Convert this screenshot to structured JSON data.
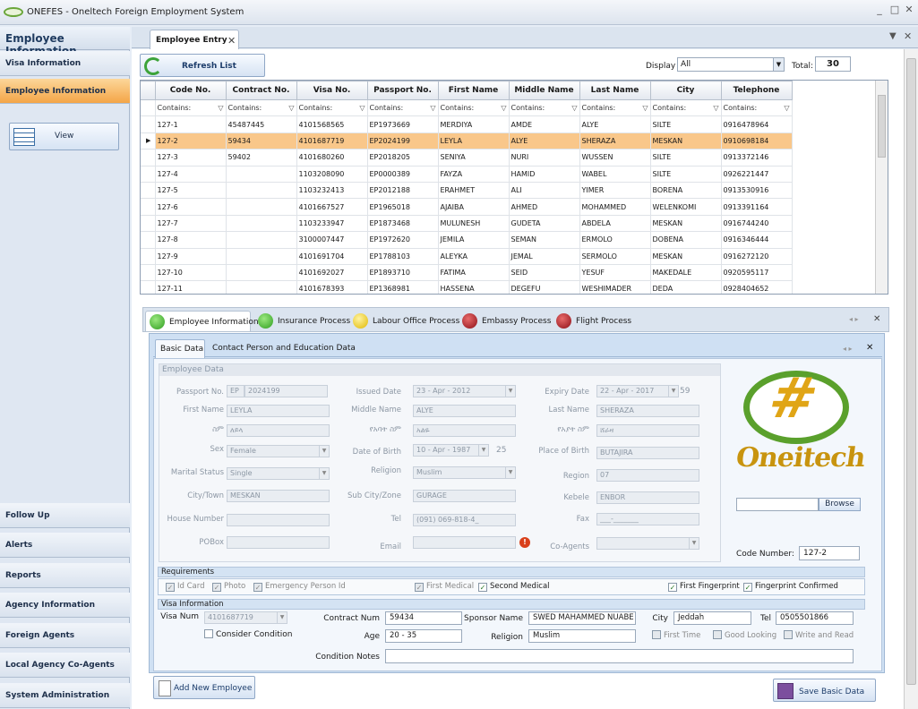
{
  "app": {
    "title": "ONEFES - Oneltech Foreign Employment System",
    "min": "_",
    "max": "□",
    "close": "✕"
  },
  "nav": {
    "header": "Employee Information",
    "view_label": "View",
    "items": [
      {
        "label": "Visa Information"
      },
      {
        "label": "Employee Information"
      },
      {
        "label": "Follow Up"
      },
      {
        "label": "Alerts"
      },
      {
        "label": "Reports"
      },
      {
        "label": "Agency Information"
      },
      {
        "label": "Foreign Agents"
      },
      {
        "label": "Local Agency Co-Agents"
      },
      {
        "label": "System Administration"
      }
    ]
  },
  "doc_tab": {
    "label": "Employee Entry",
    "close": "✕"
  },
  "toolbar": {
    "refresh_label": "Refresh List",
    "display_label": "Display",
    "display_value": "All",
    "total_label": "Total:",
    "total_value": "30"
  },
  "grid": {
    "columns": [
      "Code No.",
      "Contract No.",
      "Visa No.",
      "Passport No.",
      "First Name",
      "Middle Name",
      "Last Name",
      "City",
      "Telephone"
    ],
    "filter_text": "Contains:",
    "rows": [
      [
        "127-1",
        "45487445",
        "4101568565",
        "EP1973669",
        "MERDIYA",
        "AMDE",
        "ALYE",
        "SILTE",
        "0916478964"
      ],
      [
        "127-2",
        "59434",
        "4101687719",
        "EP2024199",
        "LEYLA",
        "ALYE",
        "SHERAZA",
        "MESKAN",
        "0910698184"
      ],
      [
        "127-3",
        "59402",
        "4101680260",
        "EP2018205",
        "SENIYA",
        "NURI",
        "WUSSEN",
        "SILTE",
        "0913372146"
      ],
      [
        "127-4",
        "",
        "1103208090",
        "EP0000389",
        "FAYZA",
        "HAMID",
        "WABEL",
        "SILTE",
        "0926221447"
      ],
      [
        "127-5",
        "",
        "1103232413",
        "EP2012188",
        "ERAHMET",
        "ALI",
        "YIMER",
        "BORENA",
        "0913530916"
      ],
      [
        "127-6",
        "",
        "4101667527",
        "EP1965018",
        "AJAIBA",
        "AHMED",
        "MOHAMMED",
        "WELENKOMI",
        "0913391164"
      ],
      [
        "127-7",
        "",
        "1103233947",
        "EP1873468",
        "MULUNESH",
        "GUDETA",
        "ABDELA",
        "MESKAN",
        "0916744240"
      ],
      [
        "127-8",
        "",
        "3100007447",
        "EP1972620",
        "JEMILA",
        "SEMAN",
        "ERMOLO",
        "DOBENA",
        "0916346444"
      ],
      [
        "127-9",
        "",
        "4101691704",
        "EP1788103",
        "ALEYKA",
        "JEMAL",
        "SERMOLO",
        "MESKAN",
        "0916272120"
      ],
      [
        "127-10",
        "",
        "4101692027",
        "EP1893710",
        "FATIMA",
        "SEID",
        "YESUF",
        "MAKEDALE",
        "0920595117"
      ],
      [
        "127-11",
        "",
        "4101678393",
        "EP1368981",
        "HASSENA",
        "DEGEFU",
        "WESHIMADER",
        "DEDA",
        "0928404652"
      ]
    ],
    "selected_row": 1
  },
  "process_tabs": [
    {
      "label": "Employee Information",
      "color": "#3fbf2e"
    },
    {
      "label": "Insurance Process",
      "color": "#3fbf2e"
    },
    {
      "label": "Labour Office Process",
      "color": "#f2d21c"
    },
    {
      "label": "Embassy Process",
      "color": "#b3141f"
    },
    {
      "label": "Flight Process",
      "color": "#b3141f"
    }
  ],
  "inner_tabs": {
    "basic": "Basic Data",
    "contact": "Contact Person and Education Data"
  },
  "employee": {
    "section": "Employee Data",
    "passport_label": "Passport No.",
    "passport_prefix": "EP",
    "passport_no": "2024199",
    "issued_label": "Issued Date",
    "issued": "23 - Apr - 2012",
    "expiry_label": "Expiry Date",
    "expiry": "22 - Apr - 2017",
    "expiry_years": "59",
    "first_name_label": "First Name",
    "first_name": "LEYLA",
    "middle_name_label": "Middle Name",
    "middle_name": "ALYE",
    "last_name_label": "Last Name",
    "last_name": "SHERAZA",
    "am_name_label": "ስም",
    "am_name": "ለይላ",
    "am_father_label": "የአባት ስም",
    "am_father": "አልዬ",
    "am_gfather_label": "የአያት ስም",
    "am_gfather": "ሸራዛ",
    "sex_label": "Sex",
    "sex": "Female",
    "dob_label": "Date of Birth",
    "dob": "10 - Apr - 1987",
    "age": "25",
    "pob_label": "Place of Birth",
    "pob": "BUTAJIRA",
    "marital_label": "Marital Status",
    "marital": "Single",
    "religion_label": "Religion",
    "religion": "Muslim",
    "region_label": "Region",
    "region": "07",
    "city_label": "City/Town",
    "city": "MESKAN",
    "subcity_label": "Sub City/Zone",
    "subcity": "GURAGE",
    "kebele_label": "Kebele",
    "kebele": "ENBOR",
    "house_label": "House Number",
    "house": "",
    "tel_label": "Tel",
    "tel": "(091) 069-818-4_",
    "fax_label": "Fax",
    "fax": "___-_______",
    "pobox_label": "POBox",
    "pobox": "",
    "email_label": "Email",
    "email": "",
    "coagents_label": "Co-Agents",
    "coagents": "",
    "browse_label": "Browse",
    "code_label": "Code Number:",
    "code": "127-2"
  },
  "logo": {
    "text": "Oneitech",
    "symbol": "#"
  },
  "requirements": {
    "header": "Requirements",
    "items": [
      {
        "label": "Id Card",
        "checked": true,
        "enabled": false
      },
      {
        "label": "Photo",
        "checked": true,
        "enabled": false
      },
      {
        "label": "Emergency Person Id",
        "checked": true,
        "enabled": false
      },
      {
        "label": "First Medical",
        "checked": true,
        "enabled": false
      },
      {
        "label": "Second Medical",
        "checked": true,
        "enabled": true
      },
      {
        "label": "First Fingerprint",
        "checked": true,
        "enabled": true
      },
      {
        "label": "Fingerprint Confirmed",
        "checked": true,
        "enabled": true
      }
    ]
  },
  "visa": {
    "header": "Visa Information",
    "visa_num_label": "Visa Num",
    "visa_num": "4101687719",
    "consider_label": "Consider Condition",
    "contract_label": "Contract Num",
    "contract": "59434",
    "sponsor_label": "Sponsor Name",
    "sponsor": "SWED MAHAMMED NUABE",
    "city_label": "City",
    "city": "Jeddah",
    "tel_label": "Tel",
    "tel": "0505501866",
    "age_label": "Age",
    "age": "20 - 35",
    "religion_label": "Religion",
    "religion": "Muslim",
    "first_time_label": "First Time",
    "good_looking_label": "Good Looking",
    "write_read_label": "Write and Read",
    "notes_label": "Condition Notes",
    "notes": ""
  },
  "actions": {
    "add": "Add New Employee",
    "save": "Save Basic Data"
  }
}
